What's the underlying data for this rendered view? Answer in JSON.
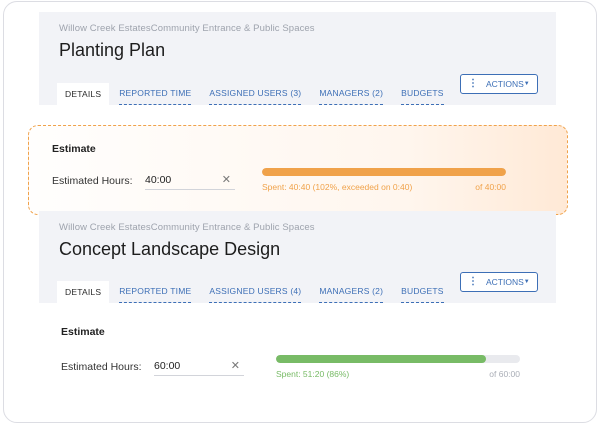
{
  "cards": [
    {
      "breadcrumb": "Willow Creek EstatesCommunity Entrance & Public Spaces",
      "title": "Planting Plan",
      "tabs": [
        "DETAILS",
        "REPORTED TIME",
        "ASSIGNED USERS (3)",
        "MANAGERS (2)",
        "BUDGETS"
      ],
      "actions_label": "ACTIONS",
      "estimate_heading": "Estimate",
      "hours_label": "Estimated Hours:",
      "hours_value": "40:00",
      "progress_fraction": 1.0,
      "progress_color": "#f0a24a",
      "spent_text": "Spent: 40:40 (102%, exceeded on 0:40)",
      "of_text": "of 40:00",
      "spent_color": "#f0a24a"
    },
    {
      "breadcrumb": "Willow Creek EstatesCommunity Entrance & Public Spaces",
      "title": "Concept Landscape Design",
      "tabs": [
        "DETAILS",
        "REPORTED TIME",
        "ASSIGNED USERS (4)",
        "MANAGERS (2)",
        "BUDGETS"
      ],
      "actions_label": "ACTIONS",
      "estimate_heading": "Estimate",
      "hours_label": "Estimated Hours:",
      "hours_value": "60:00",
      "progress_fraction": 0.86,
      "progress_color": "#78bb66",
      "spent_text": "Spent: 51:20 (86%)",
      "of_text": "of 60:00",
      "spent_color": "#78bb66"
    }
  ],
  "icons": {
    "actions": "vertical-dots-icon",
    "caret": "caret-down-icon",
    "clear": "clear-x-icon"
  }
}
